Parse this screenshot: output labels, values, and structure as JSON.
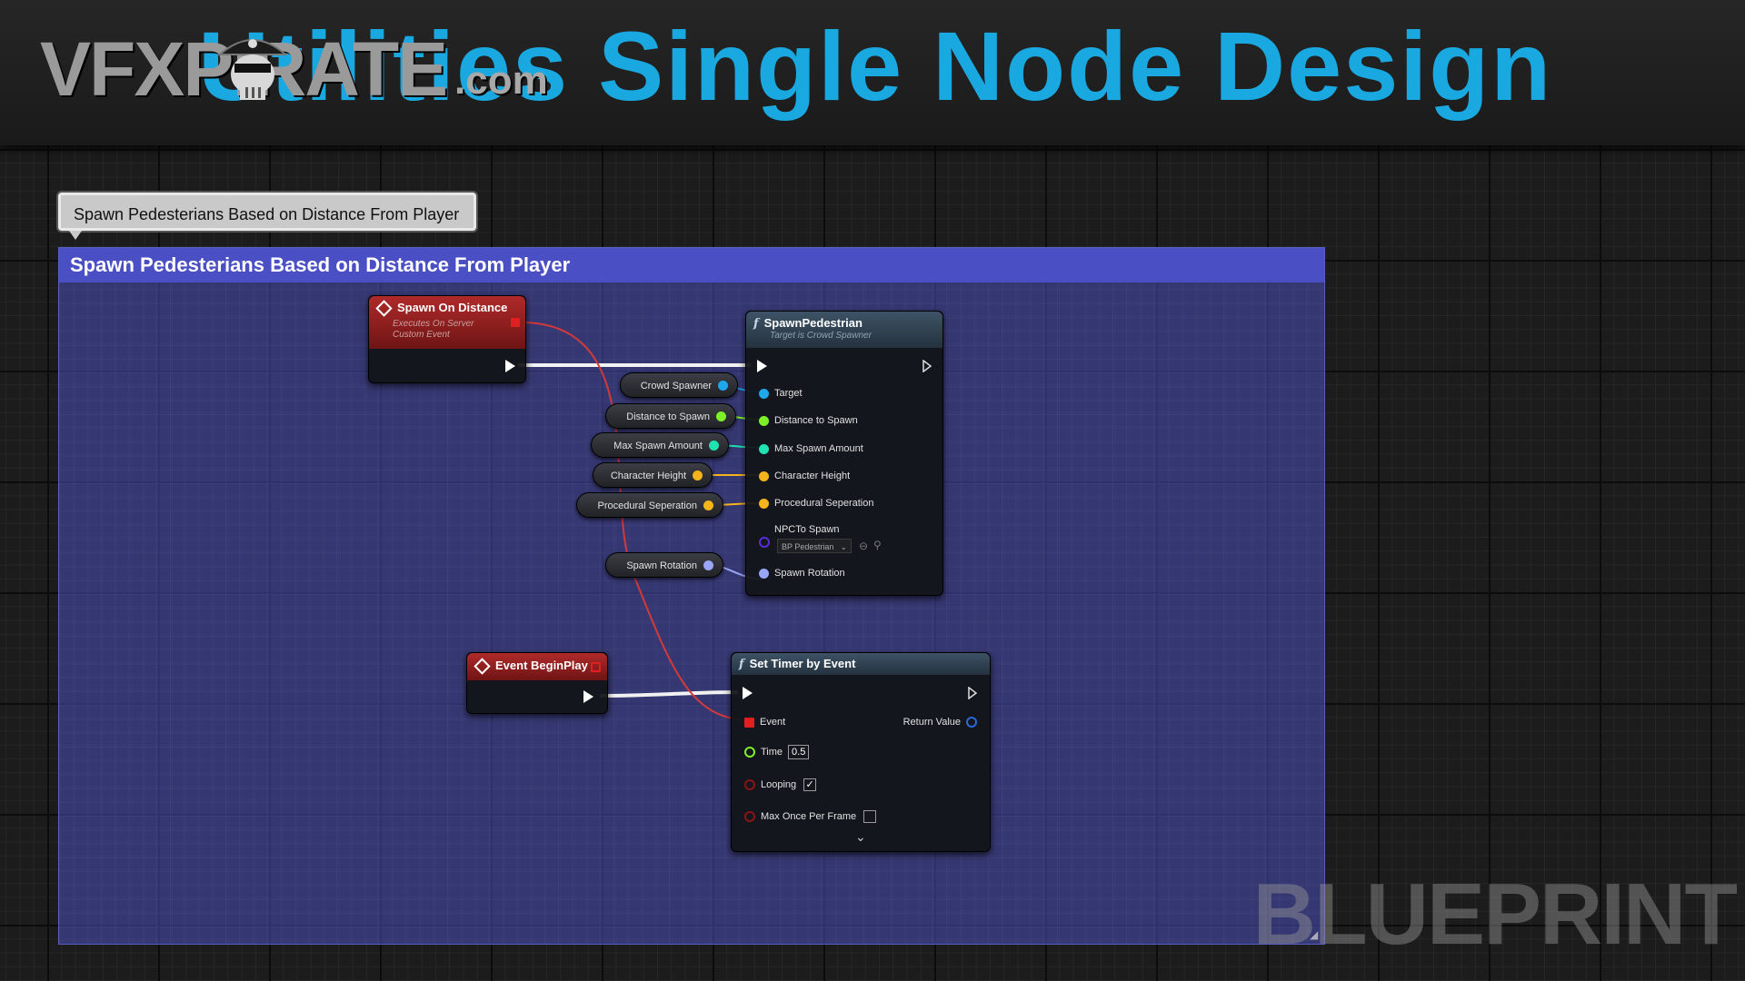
{
  "banner": {
    "logo_text": "VFXPIRATE",
    "logo_suffix": ".com",
    "headline": "Utilities Single Node Design"
  },
  "comment": {
    "bubble_text": "Spawn Pedesterians Based on Distance From Player",
    "header_text": "Spawn Pedesterians Based on Distance From Player",
    "color": "#4a4fc4"
  },
  "nodes": {
    "spawn_on_distance": {
      "title": "Spawn On Distance",
      "subtitle_1": "Executes On Server",
      "subtitle_2": "Custom Event"
    },
    "event_begin_play": {
      "title": "Event BeginPlay"
    },
    "spawn_pedestrian": {
      "title": "SpawnPedestrian",
      "subtitle": "Target is Crowd Spawner",
      "pins": {
        "target": "Target",
        "distance": "Distance to Spawn",
        "max_amount": "Max Spawn Amount",
        "height": "Character Height",
        "separation": "Procedural Seperation",
        "npc_label": "NPCTo Spawn",
        "npc_value": "BP Pedestrian",
        "rotation": "Spawn Rotation"
      }
    },
    "set_timer": {
      "title": "Set Timer by Event",
      "pins": {
        "event": "Event",
        "return_value": "Return Value",
        "time_label": "Time",
        "time_value": "0.5",
        "looping": "Looping",
        "looping_checked": true,
        "max_once": "Max Once Per Frame",
        "max_once_checked": false
      }
    }
  },
  "variables": {
    "crowd_spawner": "Crowd Spawner",
    "distance_to_spawn": "Distance to Spawn",
    "max_spawn_amount": "Max Spawn Amount",
    "character_height": "Character Height",
    "procedural_seperation": "Procedural Seperation",
    "spawn_rotation": "Spawn Rotation"
  },
  "watermark": "BLUEPRINT",
  "colors": {
    "object_pin": "#1ea7ea",
    "float_pin": "#7ef02a",
    "int_pin": "#1fe3b0",
    "struct_pin": "#f5b41a",
    "rotator_pin": "#9aa6f5",
    "class_pin": "#5a2bd8",
    "delegate_pin": "#e02020",
    "bool_pin": "#8c1414",
    "headline": "#1aa8e0"
  }
}
